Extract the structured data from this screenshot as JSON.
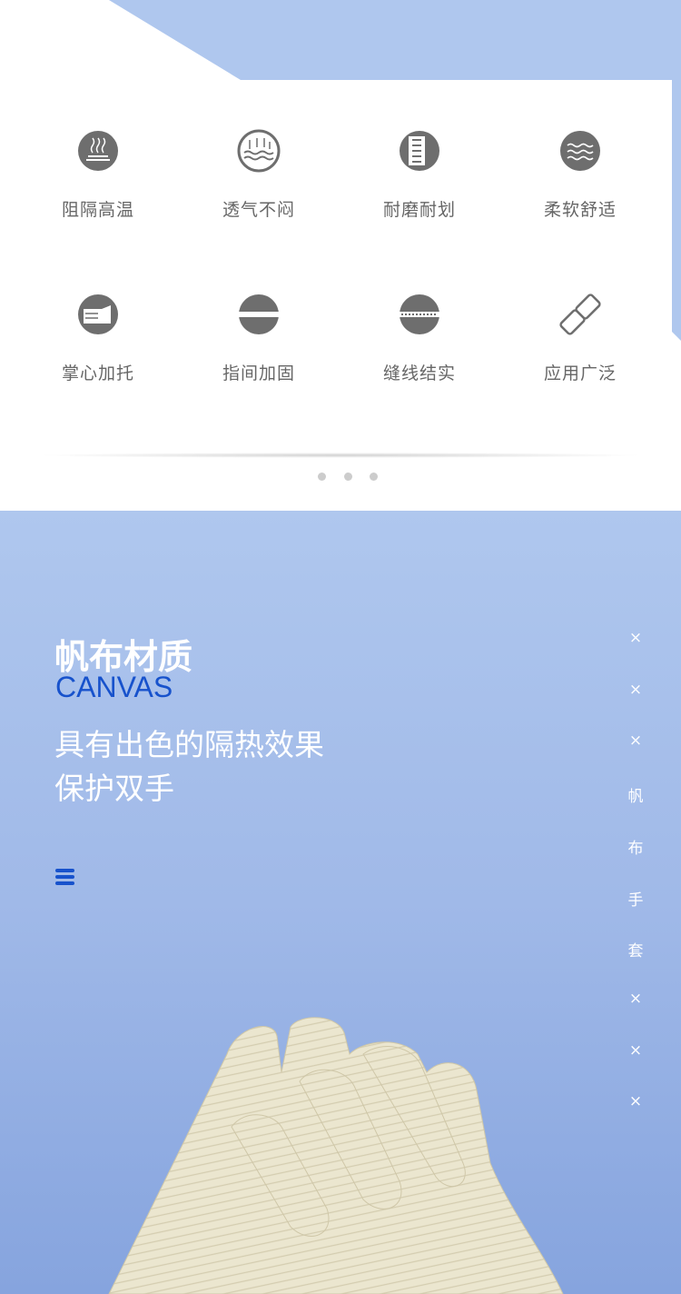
{
  "features": [
    {
      "label": "阻隔高温",
      "icon": "heat-insulation-icon"
    },
    {
      "label": "透气不闷",
      "icon": "breathable-icon"
    },
    {
      "label": "耐磨耐划",
      "icon": "wear-resistant-icon"
    },
    {
      "label": "柔软舒适",
      "icon": "soft-waves-icon"
    },
    {
      "label": "掌心加托",
      "icon": "palm-icon"
    },
    {
      "label": "指间加固",
      "icon": "reinforced-finger-icon"
    },
    {
      "label": "缝线结实",
      "icon": "stitching-icon"
    },
    {
      "label": "应用广泛",
      "icon": "link-icon"
    }
  ],
  "carousel": {
    "dots": 3
  },
  "section": {
    "title": "帆布材质",
    "subtitle": "CANVAS",
    "desc_line1": "具有出色的隔热效果",
    "desc_line2": "保护双手",
    "side_items": [
      "×",
      "×",
      "×",
      "帆",
      "布",
      "手",
      "套",
      "×",
      "×",
      "×"
    ]
  },
  "colors": {
    "accent": "#1752cc",
    "light_blue": "#afc7ee",
    "icon_gray": "#6e6e6e"
  }
}
